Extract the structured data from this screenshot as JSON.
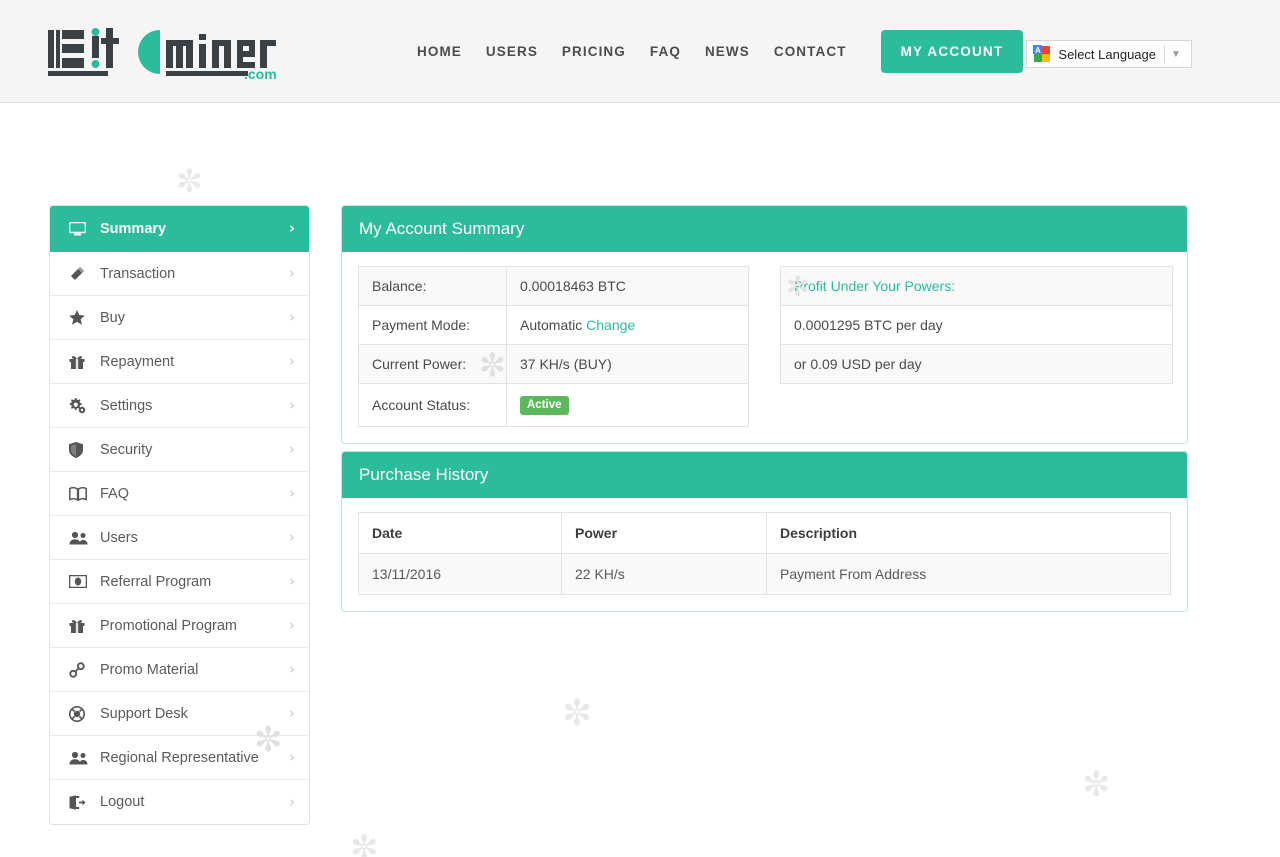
{
  "header": {
    "logo": {
      "text_left": "B!t",
      "text_right": "m!ner",
      "suffix": ".com",
      "accent": "#2bbc9b"
    },
    "nav": [
      {
        "label": "HOME",
        "name": "nav-home"
      },
      {
        "label": "USERS",
        "name": "nav-users"
      },
      {
        "label": "PRICING",
        "name": "nav-pricing"
      },
      {
        "label": "FAQ",
        "name": "nav-faq"
      },
      {
        "label": "NEWS",
        "name": "nav-news"
      },
      {
        "label": "CONTACT",
        "name": "nav-contact"
      }
    ],
    "cta_label": "MY ACCOUNT",
    "translate": {
      "label": "Select Language",
      "caret": "▼",
      "icon": "google-translate-icon"
    }
  },
  "sidebar": {
    "items": [
      {
        "label": "Summary",
        "icon": "desktop-icon",
        "active": true
      },
      {
        "label": "Transaction",
        "icon": "magic-wand-icon",
        "active": false
      },
      {
        "label": "Buy",
        "icon": "star-icon",
        "active": false
      },
      {
        "label": "Repayment",
        "icon": "gift-icon",
        "active": false
      },
      {
        "label": "Settings",
        "icon": "gears-icon",
        "active": false
      },
      {
        "label": "Security",
        "icon": "shield-icon",
        "active": false
      },
      {
        "label": "FAQ",
        "icon": "book-icon",
        "active": false
      },
      {
        "label": "Users",
        "icon": "users-icon",
        "active": false
      },
      {
        "label": "Referral Program",
        "icon": "money-bill-icon",
        "active": false
      },
      {
        "label": "Promotional Program",
        "icon": "gift-icon",
        "active": false
      },
      {
        "label": "Promo Material",
        "icon": "link-chain-icon",
        "active": false
      },
      {
        "label": "Support Desk",
        "icon": "lifebuoy-icon",
        "active": false
      },
      {
        "label": "Regional Representative",
        "icon": "users-icon",
        "active": false
      },
      {
        "label": "Logout",
        "icon": "sign-out-icon",
        "active": false
      }
    ],
    "caret": "›"
  },
  "summary": {
    "title": "My Account Summary",
    "rows": [
      {
        "label": "Balance:",
        "value": "0.00018463 BTC"
      },
      {
        "label": "Payment Mode:",
        "value": "Automatic",
        "link": "Change"
      },
      {
        "label": "Current Power:",
        "value": "37 KH/s (BUY)"
      },
      {
        "label": "Account Status:",
        "badge": "Active"
      }
    ],
    "profit": {
      "title": "Profit Under Your Powers:",
      "btc": "0.0001295 BTC per day",
      "usd": "or 0.09 USD per day"
    }
  },
  "history": {
    "title": "Purchase History",
    "columns": [
      "Date",
      "Power",
      "Description"
    ],
    "rows": [
      {
        "date": "13/11/2016",
        "power": "22 KH/s",
        "description": "Payment From Address"
      }
    ]
  },
  "decor": {
    "snowflake": "✼"
  },
  "colors": {
    "brand": "#2bbc9b",
    "badge_green": "#5cb85c",
    "header_bg": "#f5f5f5"
  }
}
